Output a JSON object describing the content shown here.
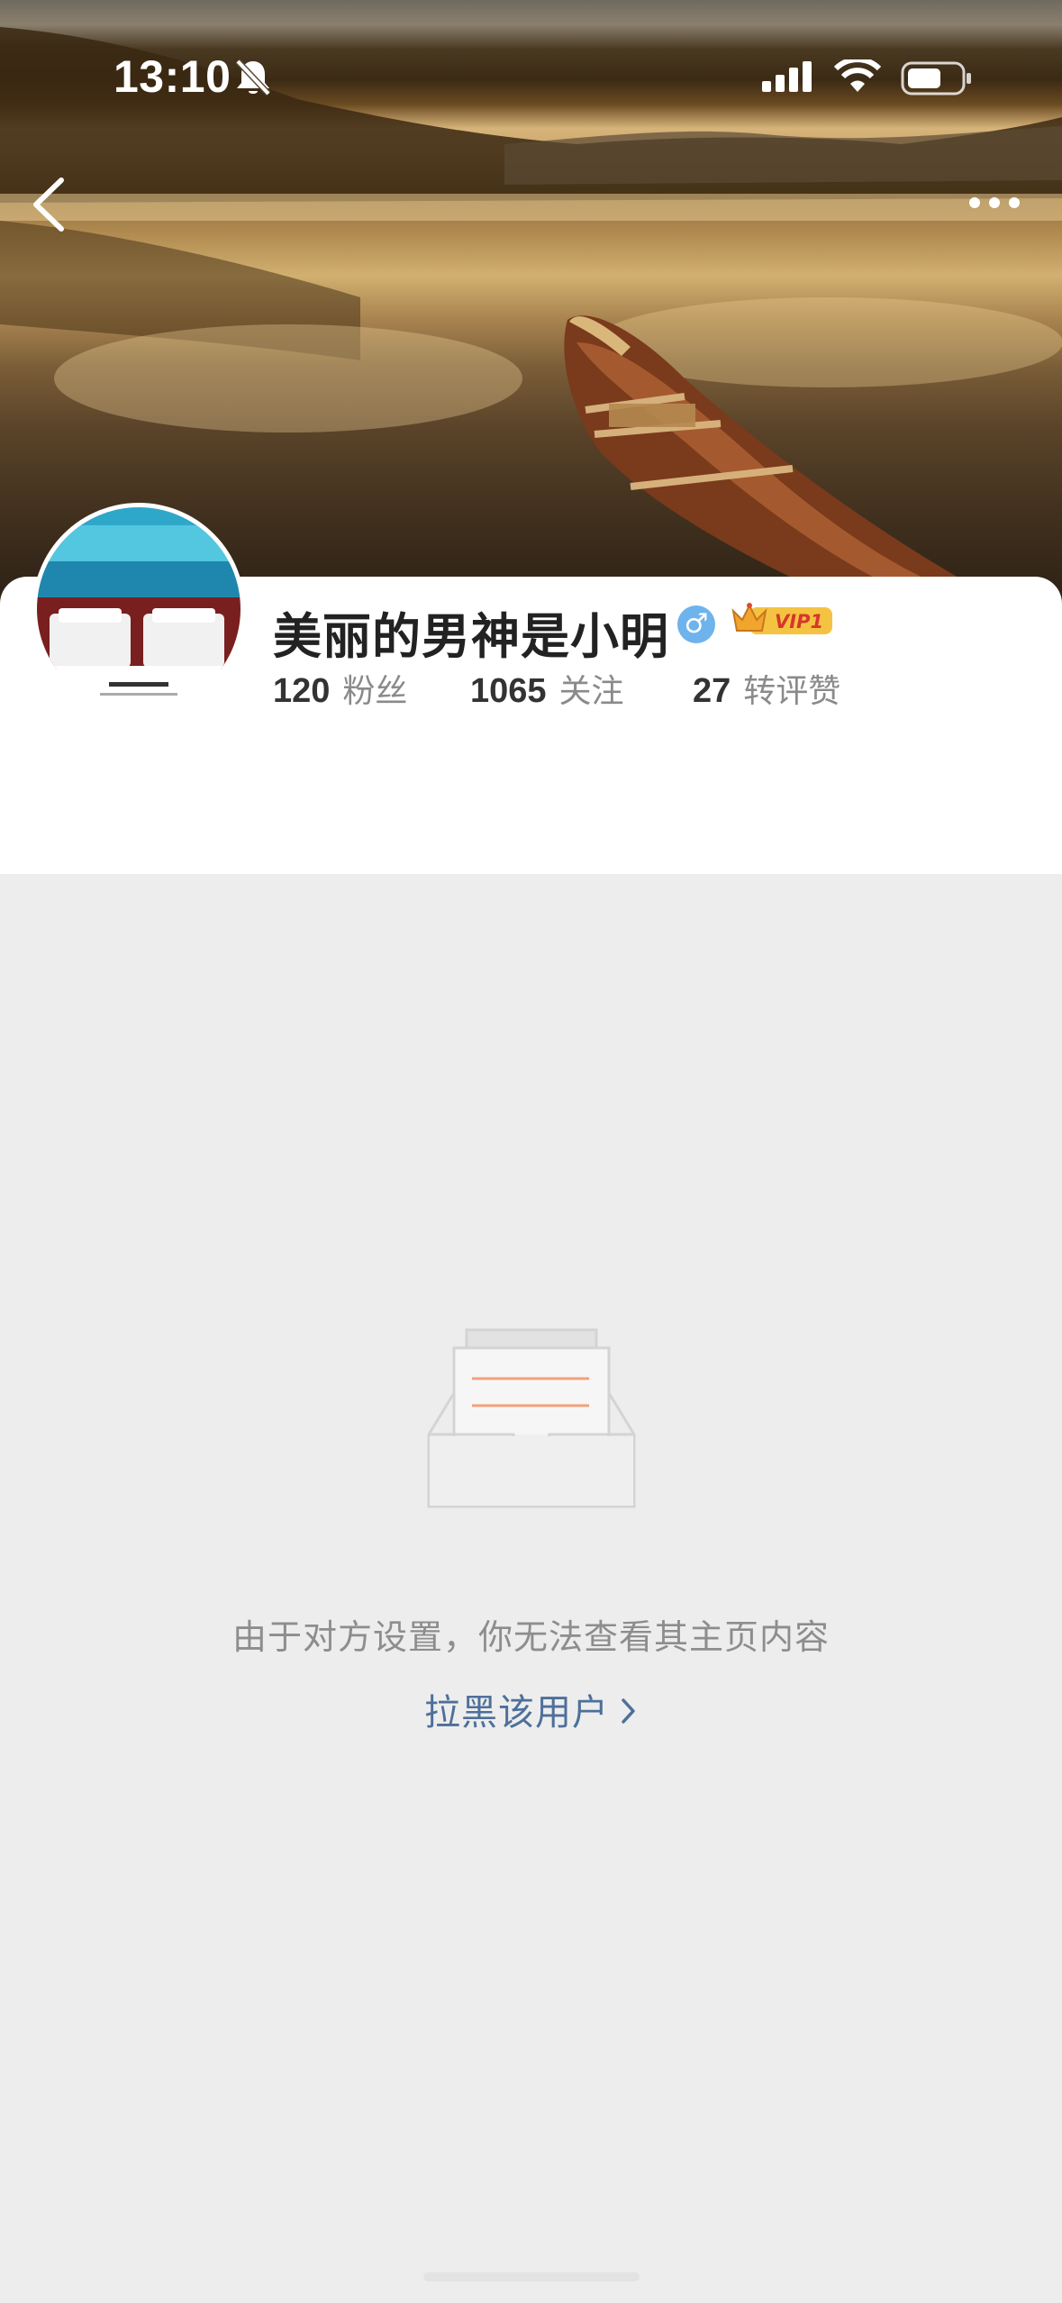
{
  "status_bar": {
    "time": "13:10",
    "bell_icon": "bell-muted-icon",
    "signal_icon": "cellular-signal-icon",
    "wifi_icon": "wifi-icon",
    "battery_icon": "battery-icon"
  },
  "nav": {
    "back_icon": "chevron-left-icon",
    "more_icon": "more-dots-icon"
  },
  "profile": {
    "username": "美丽的男神是小明",
    "gender_symbol": "♂",
    "vip_label": "VIP1",
    "stats": [
      {
        "value": "120",
        "label": "粉丝"
      },
      {
        "value": "1065",
        "label": "关注"
      },
      {
        "value": "27",
        "label": "转评赞"
      }
    ]
  },
  "empty_state": {
    "icon": "empty-inbox-icon",
    "message": "由于对方设置，你无法查看其主页内容",
    "action_label": "拉黑该用户"
  },
  "colors": {
    "page_background": "#ededed",
    "card_background": "#ffffff",
    "link_blue": "#4e6f9a",
    "gender_blue": "#6fb3ec",
    "vip_gold": "#f5c342",
    "empty_line_orange": "#f4a07a"
  }
}
